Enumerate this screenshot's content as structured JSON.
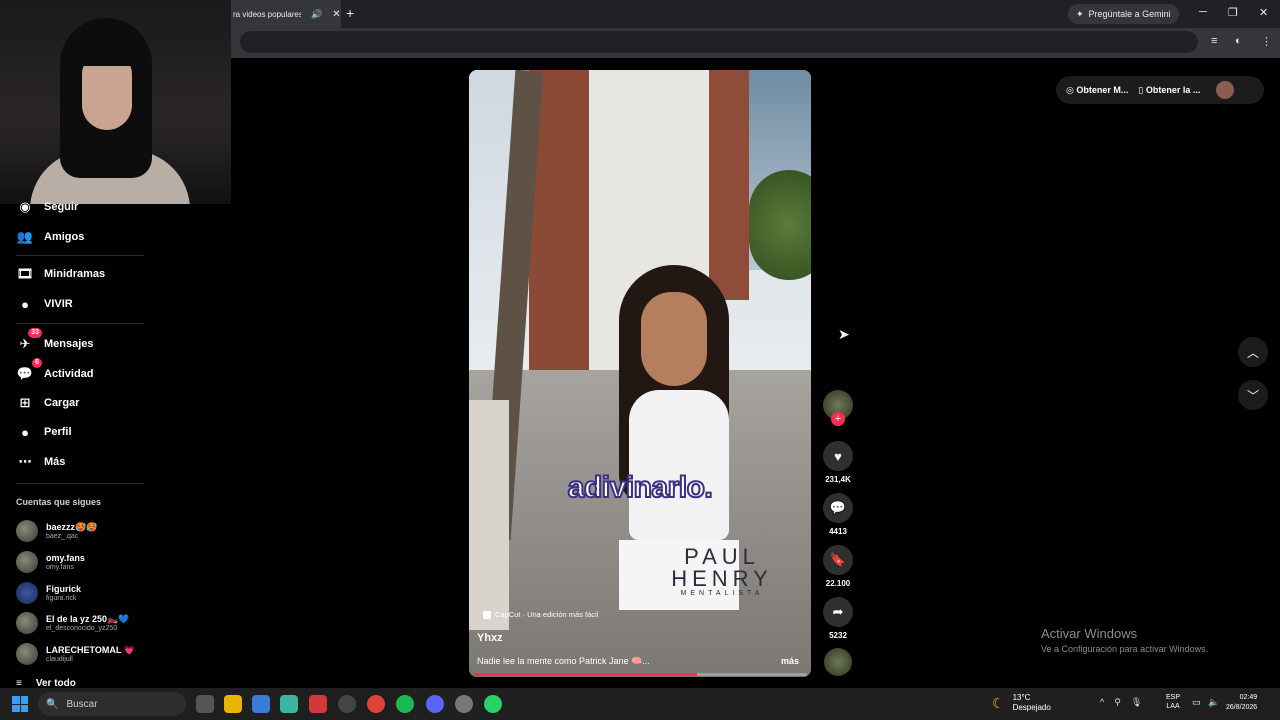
{
  "browser": {
    "tab_title": "ra videos populares d",
    "tab_audio_icon": "speaker-icon",
    "tab_close": "✕",
    "new_tab": "+",
    "gemini_label": "Pregúntale a Gemini",
    "window_controls": [
      "─",
      "❐",
      "✕"
    ]
  },
  "sidebar": {
    "items": [
      {
        "label": "Seguir",
        "icon": "following-icon"
      },
      {
        "label": "Amigos",
        "icon": "friends-icon"
      },
      {
        "label": "Minidramas",
        "icon": "film-icon"
      },
      {
        "label": "VIVIR",
        "icon": "live-icon"
      },
      {
        "label": "Mensajes",
        "icon": "messages-icon",
        "badge": "33"
      },
      {
        "label": "Actividad",
        "icon": "activity-icon",
        "badge": "6"
      },
      {
        "label": "Cargar",
        "icon": "upload-icon"
      },
      {
        "label": "Perfil",
        "icon": "profile-icon"
      },
      {
        "label": "Más",
        "icon": "more-icon"
      }
    ],
    "following_title": "Cuentas que sigues",
    "following": [
      {
        "name": "baezzz🥵🥵",
        "handle": "baez_.qac"
      },
      {
        "name": "omy.fans",
        "handle": "omy.fans"
      },
      {
        "name": "Figurick",
        "handle": "figura.rick"
      },
      {
        "name": "El de la yz 250🏍️💙",
        "handle": "el_desconocido_yz250"
      },
      {
        "name": "LARECHETOMAL 💗",
        "handle": "claudijull"
      }
    ],
    "see_all": "Ver todo"
  },
  "video": {
    "overlay_caption": "adivinarlo.",
    "watermark_line1": "PAUL",
    "watermark_line2": "HENRY",
    "watermark_line3": "MENTALISTA",
    "capcut_label": "CapCut · Una edición más fácil",
    "author": "Yhxz",
    "description": "Nadie lee la mente como Patrick Jane 🧠...",
    "more": "más",
    "progress": 0.67
  },
  "actions": {
    "follow_plus": "+",
    "likes": "231,4K",
    "comments": "4413",
    "saves": "22.100",
    "shares": "5232"
  },
  "topright": {
    "get_app": "Obtener M...",
    "get_desktop": "Obtener la ..."
  },
  "activation": {
    "title": "Activar Windows",
    "subtitle": "Ve a Configuración para activar Windows."
  },
  "taskbar": {
    "search_placeholder": "Buscar",
    "temperature": "13°C",
    "weather": "Despejado",
    "lang1": "ESP",
    "lang2": "LAA",
    "time": "02:49",
    "date": "26/8/2026"
  },
  "colors": {
    "accent": "#fe2c55",
    "caption_stroke": "#3b2f86",
    "background": "#000000"
  }
}
